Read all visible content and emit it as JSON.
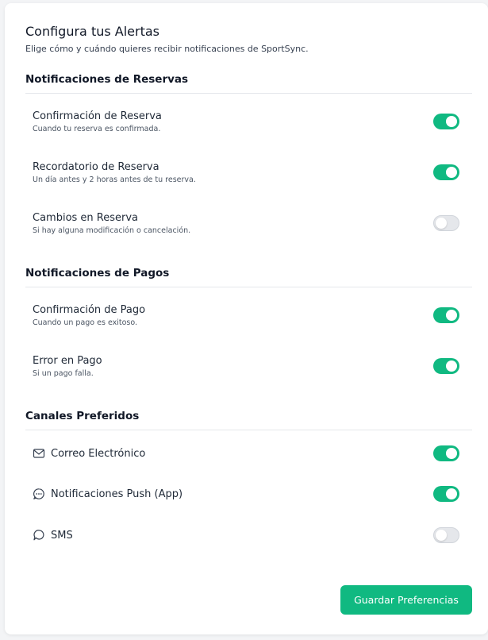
{
  "header": {
    "title": "Configura tus Alertas",
    "subtitle": "Elige cómo y cuándo quieres recibir notificaciones de SportSync."
  },
  "sections": {
    "reservas": {
      "title": "Notificaciones de Reservas",
      "items": [
        {
          "label": "Confirmación de Reserva",
          "description": "Cuando tu reserva es confirmada.",
          "enabled": true
        },
        {
          "label": "Recordatorio de Reserva",
          "description": "Un día antes y 2 horas antes de tu reserva.",
          "enabled": true
        },
        {
          "label": "Cambios en Reserva",
          "description": "Si hay alguna modificación o cancelación.",
          "enabled": false
        }
      ]
    },
    "pagos": {
      "title": "Notificaciones de Pagos",
      "items": [
        {
          "label": "Confirmación de Pago",
          "description": "Cuando un pago es exitoso.",
          "enabled": true
        },
        {
          "label": "Error en Pago",
          "description": "Si un pago falla.",
          "enabled": true
        }
      ]
    },
    "canales": {
      "title": "Canales Preferidos",
      "items": [
        {
          "label": "Correo Electrónico",
          "icon": "mail-icon",
          "enabled": true
        },
        {
          "label": "Notificaciones Push (App)",
          "icon": "chat-bubble-dots-icon",
          "enabled": true
        },
        {
          "label": "SMS",
          "icon": "message-bubble-icon",
          "enabled": false
        }
      ]
    }
  },
  "actions": {
    "save_label": "Guardar Preferencias"
  },
  "colors": {
    "accent": "#10b981",
    "toggle_off": "#e5e7eb"
  }
}
